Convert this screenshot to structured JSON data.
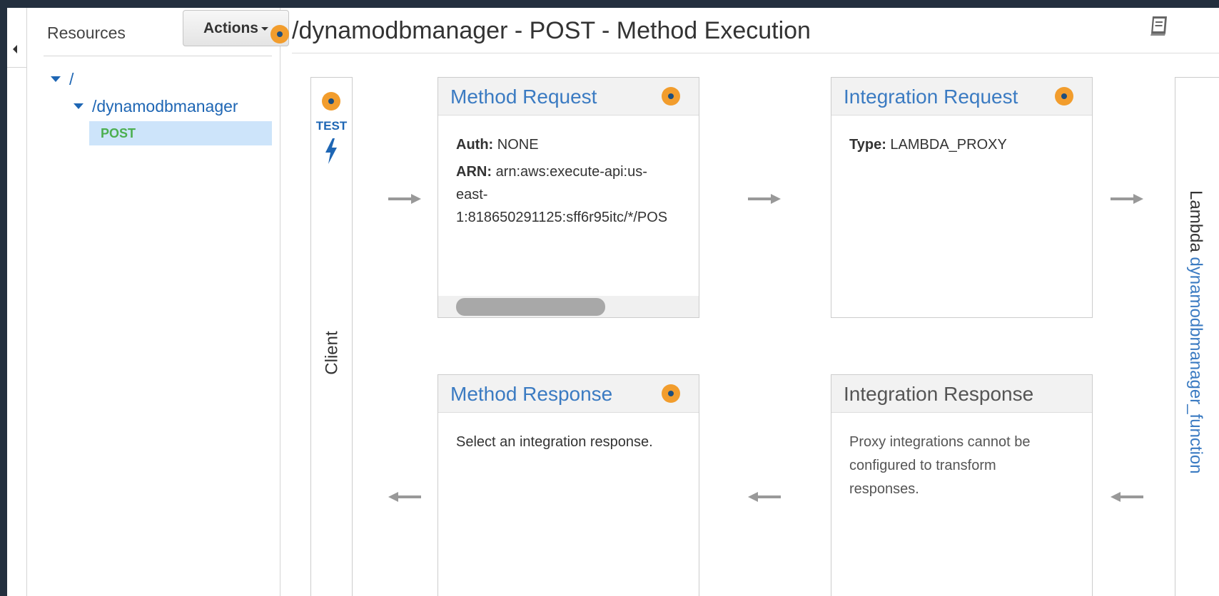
{
  "sidebar": {
    "resources_label": "Resources",
    "actions_label": "Actions",
    "tree": {
      "root": "/",
      "resource": "/dynamodbmanager",
      "method": "POST"
    }
  },
  "page": {
    "title": "/dynamodbmanager - POST - Method Execution"
  },
  "client": {
    "test_label": "TEST",
    "label": "Client"
  },
  "method_request": {
    "title": "Method Request",
    "auth_label": "Auth:",
    "auth_value": "NONE",
    "arn_label": "ARN:",
    "arn_line1": "arn:aws:execute-api:us-",
    "arn_line2": "east-",
    "arn_line3": "1:818650291125:sff6r95itc/*/POS"
  },
  "integration_request": {
    "title": "Integration Request",
    "type_label": "Type:",
    "type_value": "LAMBDA_PROXY"
  },
  "method_response": {
    "title": "Method Response",
    "body": "Select an integration response."
  },
  "integration_response": {
    "title": "Integration Response",
    "body_line1": "Proxy integrations cannot be",
    "body_line2": "configured to transform",
    "body_line3": "responses."
  },
  "lambda": {
    "prefix": "Lambda",
    "function_name": "dynamodbmanager_function"
  },
  "colors": {
    "accent_blue": "#3b7bc2",
    "link_blue": "#1e66b4",
    "method_green": "#4caf50",
    "status_dot_orange": "#f29d2d",
    "frame_dark": "#232f3e"
  },
  "icons": {
    "book": "book-icon",
    "bolt": "lightning-bolt-icon",
    "status": "status-dot-icon"
  }
}
